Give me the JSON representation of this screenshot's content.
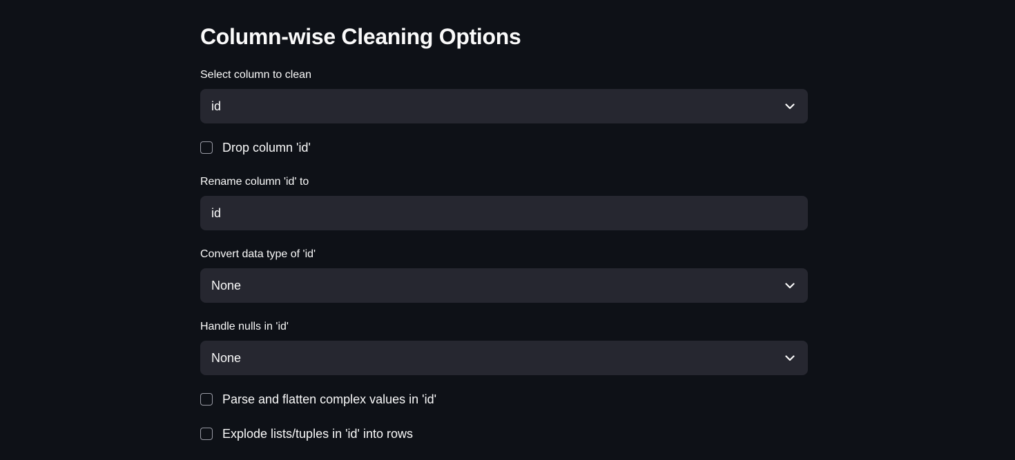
{
  "page": {
    "title": "Column-wise Cleaning Options"
  },
  "select_column": {
    "label": "Select column to clean",
    "value": "id"
  },
  "drop_column": {
    "label": "Drop column 'id'",
    "checked": false
  },
  "rename_column": {
    "label": "Rename column 'id' to",
    "value": "id"
  },
  "convert_type": {
    "label": "Convert data type of 'id'",
    "value": "None"
  },
  "handle_nulls": {
    "label": "Handle nulls in 'id'",
    "value": "None"
  },
  "parse_flatten": {
    "label": "Parse and flatten complex values in 'id'",
    "checked": false
  },
  "explode_lists": {
    "label": "Explode lists/tuples in 'id' into rows",
    "checked": false
  },
  "icons": {
    "dropdown": "chevron-down-icon"
  },
  "colors": {
    "background": "#0e1117",
    "input_background": "#262730",
    "text": "#fafafa",
    "checkbox_border": "#9a9ca6"
  }
}
